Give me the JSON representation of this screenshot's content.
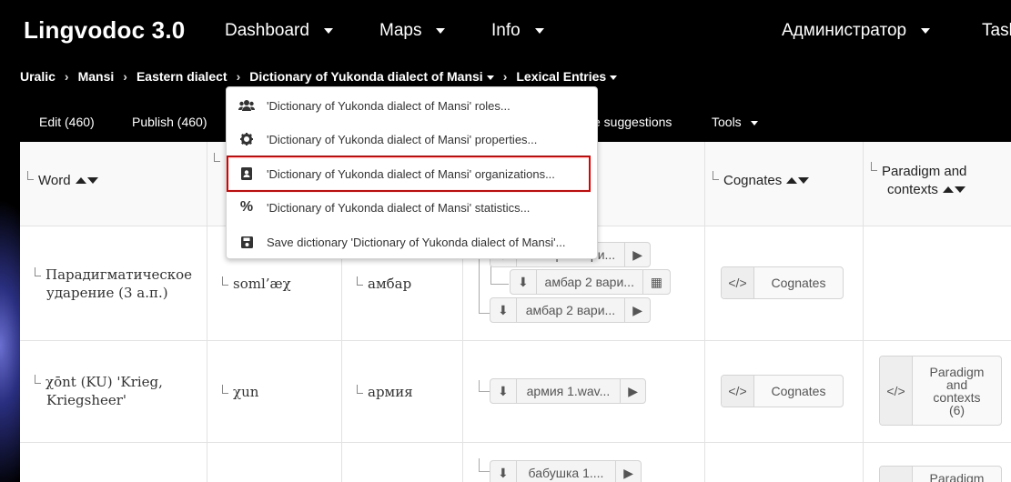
{
  "nav": {
    "brand": "Lingvodoc 3.0",
    "items": [
      {
        "label": "Dashboard"
      },
      {
        "label": "Maps"
      },
      {
        "label": "Info"
      }
    ],
    "user": "Администратор",
    "tasks": "Tasks"
  },
  "breadcrumb": {
    "items": [
      "Uralic",
      "Mansi",
      "Eastern dialect",
      "Dictionary of Yukonda dialect of Mansi",
      "Lexical Entries"
    ]
  },
  "toolbar": {
    "edit": "Edit (460)",
    "publish": "Publish (460)",
    "suggestions": "e suggestions",
    "tools": "Tools"
  },
  "menu": {
    "items": [
      {
        "label": "'Dictionary of Yukonda dialect of Mansi' roles...",
        "icon": "users-icon"
      },
      {
        "label": "'Dictionary of Yukonda dialect of Mansi' properties...",
        "icon": "gear-icon"
      },
      {
        "label": "'Dictionary of Yukonda dialect of Mansi' organizations...",
        "icon": "address-card-icon",
        "highlighted": true
      },
      {
        "label": "'Dictionary of Yukonda dialect of Mansi' statistics...",
        "icon": "percent-icon"
      },
      {
        "label": "Save dictionary 'Dictionary of Yukonda dialect of Mansi'...",
        "icon": "save-icon"
      }
    ]
  },
  "table": {
    "headers": {
      "word": "Word",
      "cognates": "Cognates",
      "paradigm_line1": "Paradigm and",
      "paradigm_line2": "contexts"
    },
    "rows": [
      {
        "word_line1": "Парадигматическое",
        "word_line2": "ударение (3 а.п.)",
        "transcription": "soml’æχ",
        "translation": "амбар",
        "audio": [
          "амбар 2 вари...",
          "амбар 2 вари...",
          "амбар 2 вари..."
        ],
        "cognates": "Cognates"
      },
      {
        "word_line1": "χōnt (KU) 'Krieg,",
        "word_line2": "Kriegsheer'",
        "transcription": "χun",
        "translation": "армия",
        "audio": [
          "армия 1.wav..."
        ],
        "cognates": "Cognates",
        "paradigm_line1": "Paradigm",
        "paradigm_line2": "and",
        "paradigm_line3": "contexts",
        "paradigm_line4": "(6)"
      },
      {
        "audio": [
          "бабушка 1...."
        ],
        "paradigm_line1": "Paradigm"
      }
    ]
  },
  "colors": {
    "highlight": "#dd0000",
    "nav_bg": "#000000",
    "table_bg": "#ffffff"
  }
}
